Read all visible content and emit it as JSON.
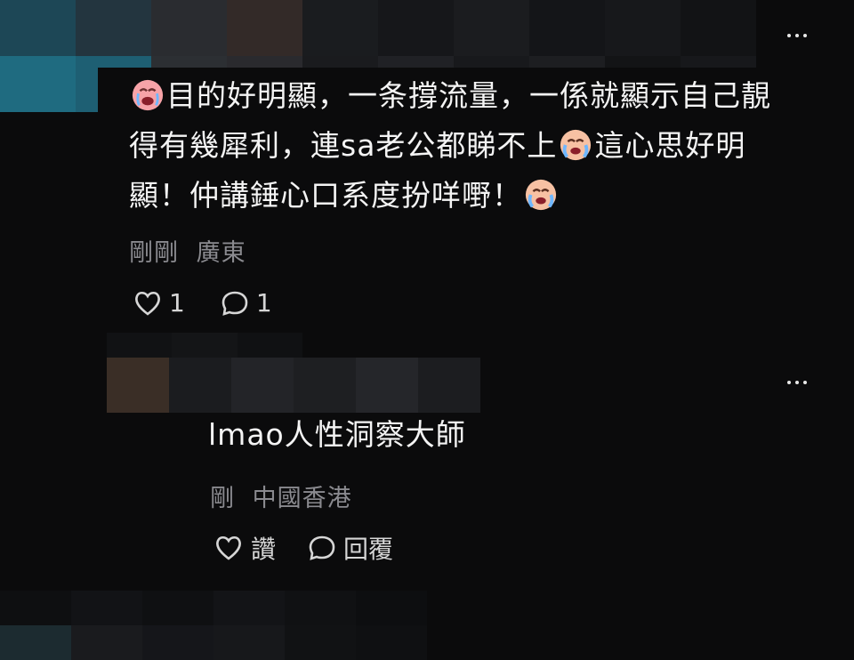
{
  "comment1": {
    "text_line1": "目的好明顯，一条撐流量，一係就顯示自己靚",
    "text_line2_a": "得有幾犀利，連sa老公都睇不上",
    "text_line2_b": "這心思好明",
    "text_line3": "顯！仲講錘心口系度扮咩嘢！",
    "meta_time": "剛剛",
    "meta_location": "廣東",
    "like_count": "1",
    "comment_count": "1",
    "emoji": "crying-face-emoji"
  },
  "comment2": {
    "text": "lmao人性洞察大師",
    "meta_time": "剛",
    "meta_location": "中國香港",
    "like_label": "讚",
    "reply_label": "回覆"
  },
  "icons": {
    "more": "more-dots-icon",
    "like": "heart-outline-icon",
    "comment": "speech-bubble-icon"
  },
  "colors": {
    "background": "#0b0b0c",
    "text": "#f4f4f4",
    "meta": "#8a8a8f"
  }
}
